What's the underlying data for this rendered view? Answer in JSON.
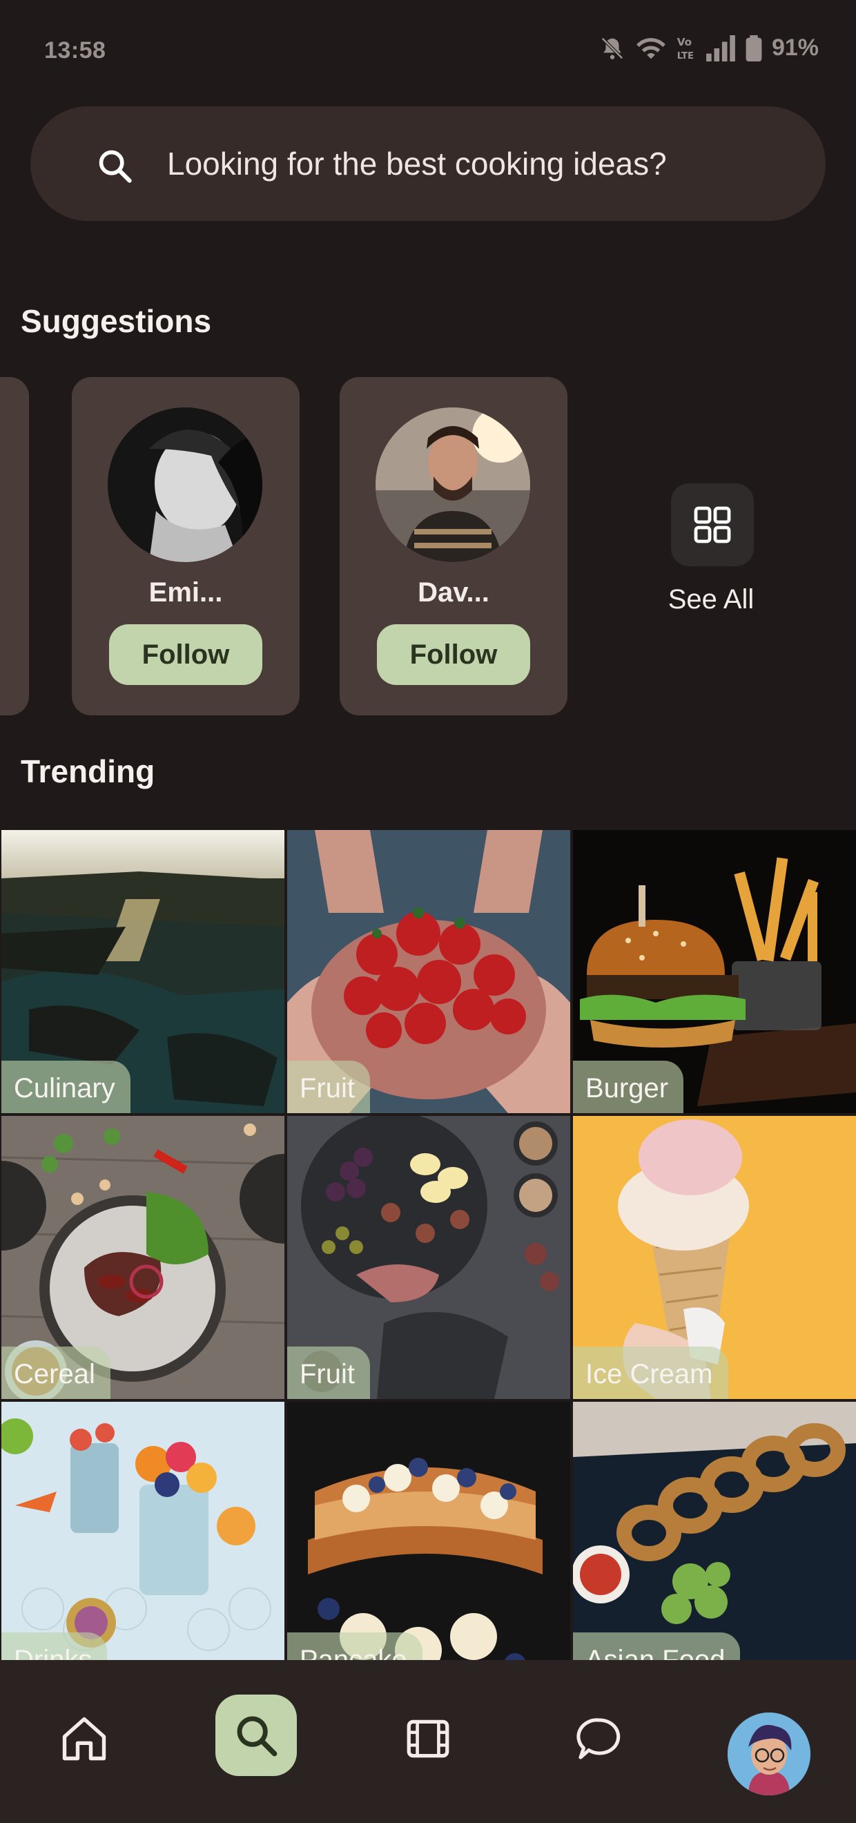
{
  "status_bar": {
    "time": "13:58",
    "battery": "91%",
    "icons": [
      "notifications-off-icon",
      "wifi-icon",
      "volte-icon",
      "signal-icon",
      "battery-icon"
    ]
  },
  "search": {
    "placeholder": "Looking for the best cooking ideas?",
    "icon": "search-icon"
  },
  "suggestions": {
    "title": "Suggestions",
    "users": [
      {
        "name": "Emi...",
        "follow_label": "Follow"
      },
      {
        "name": "Dav...",
        "follow_label": "Follow"
      }
    ],
    "see_all_label": "See All"
  },
  "trending": {
    "title": "Trending",
    "tiles": [
      {
        "label": "Culinary"
      },
      {
        "label": "Fruit"
      },
      {
        "label": "Burger"
      },
      {
        "label": "Cereal"
      },
      {
        "label": "Fruit"
      },
      {
        "label": "Ice Cream"
      },
      {
        "label": "Drinks"
      },
      {
        "label": "Pancake"
      },
      {
        "label": "Asian Food"
      }
    ]
  },
  "bottom_nav": {
    "items": [
      "home-icon",
      "search-icon",
      "video-icon",
      "chat-icon",
      "profile-avatar"
    ],
    "active": "search-icon"
  },
  "colors": {
    "background": "#1f1a19",
    "search_bg": "#372b29",
    "card_bg": "#4a3c39",
    "accent_green": "#c2d4ac",
    "nav_bg": "#2b2322"
  }
}
